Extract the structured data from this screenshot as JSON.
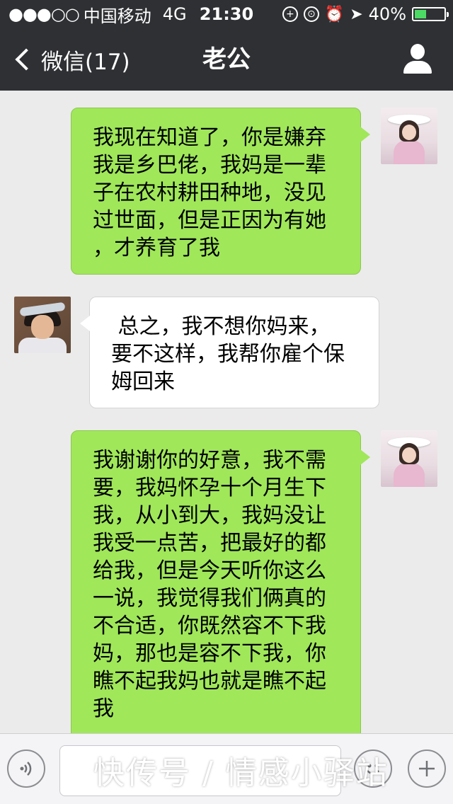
{
  "status_bar": {
    "signal": "●●●○○",
    "carrier": "中国移动",
    "network": "4G",
    "time": "21:30",
    "battery": "40%",
    "battery_level": 0.4
  },
  "nav": {
    "back_label": "微信(17)",
    "title": "老公"
  },
  "messages": [
    {
      "sender": "me",
      "text": "我现在知道了，你是嫌弃\n我是乡巴佬，我妈是一辈\n子在农村耕田种地，没见\n过世面，但是正因为有她\n，才养育了我"
    },
    {
      "sender": "other",
      "text": " 总之，我不想你妈来，\n要不这样，我帮你雇个保\n姆回来"
    },
    {
      "sender": "me",
      "text": "我谢谢你的好意，我不需\n要，我妈怀孕十个月生下\n我，从小到大，我妈没让\n我受一点苦，把最好的都\n给我，但是今天听你这么\n一说，我觉得我们俩真的\n不合适，你既然容不下我\n妈，那也是容不下我，你\n瞧不起我妈也就是瞧不起\n我"
    }
  ],
  "input_bar": {
    "voice_icon": "voice-icon",
    "emoji_icon": "emoji-icon",
    "plus_icon": "plus-icon",
    "text_value": ""
  },
  "watermark": "快传号 / 情感小驿站",
  "colors": {
    "bar_bg": "#2e3033",
    "chat_bg": "#ebebeb",
    "outgoing_bubble": "#a0e75a",
    "incoming_bubble": "#ffffff"
  }
}
